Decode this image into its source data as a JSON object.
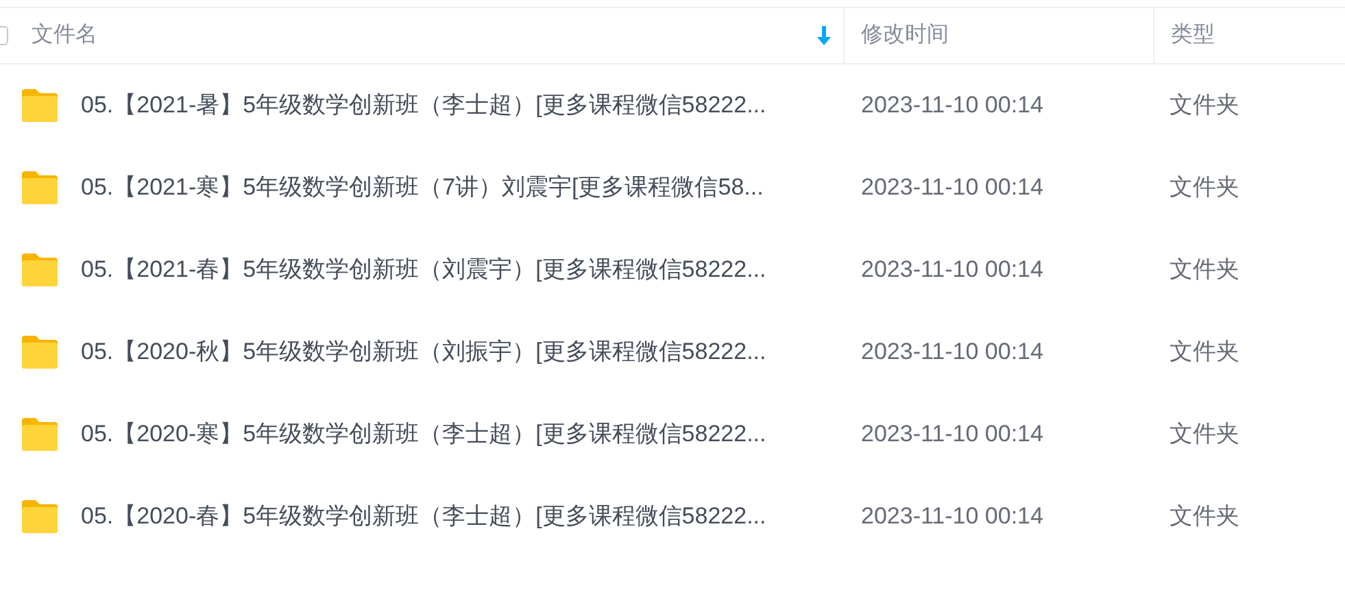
{
  "header": {
    "select_all": {
      "checked": false
    },
    "columns": [
      {
        "label": "文件名",
        "sorted": true
      },
      {
        "label": "修改时间",
        "sorted": false
      },
      {
        "label": "类型",
        "sorted": false
      }
    ]
  },
  "rows": [
    {
      "name": "05.【2021-暑】5年级数学创新班（李士超）[更多课程微信58222...",
      "modified": "2023-11-10 00:14",
      "type": "文件夹"
    },
    {
      "name": "05.【2021-寒】5年级数学创新班（7讲）刘震宇[更多课程微信58...",
      "modified": "2023-11-10 00:14",
      "type": "文件夹"
    },
    {
      "name": "05.【2021-春】5年级数学创新班（刘震宇）[更多课程微信58222...",
      "modified": "2023-11-10 00:14",
      "type": "文件夹"
    },
    {
      "name": "05.【2020-秋】5年级数学创新班（刘振宇）[更多课程微信58222...",
      "modified": "2023-11-10 00:14",
      "type": "文件夹"
    },
    {
      "name": "05.【2020-寒】5年级数学创新班（李士超）[更多课程微信58222...",
      "modified": "2023-11-10 00:14",
      "type": "文件夹"
    },
    {
      "name": "05.【2020-春】5年级数学创新班（李士超）[更多课程微信58222...",
      "modified": "2023-11-10 00:14",
      "type": "文件夹"
    }
  ]
}
